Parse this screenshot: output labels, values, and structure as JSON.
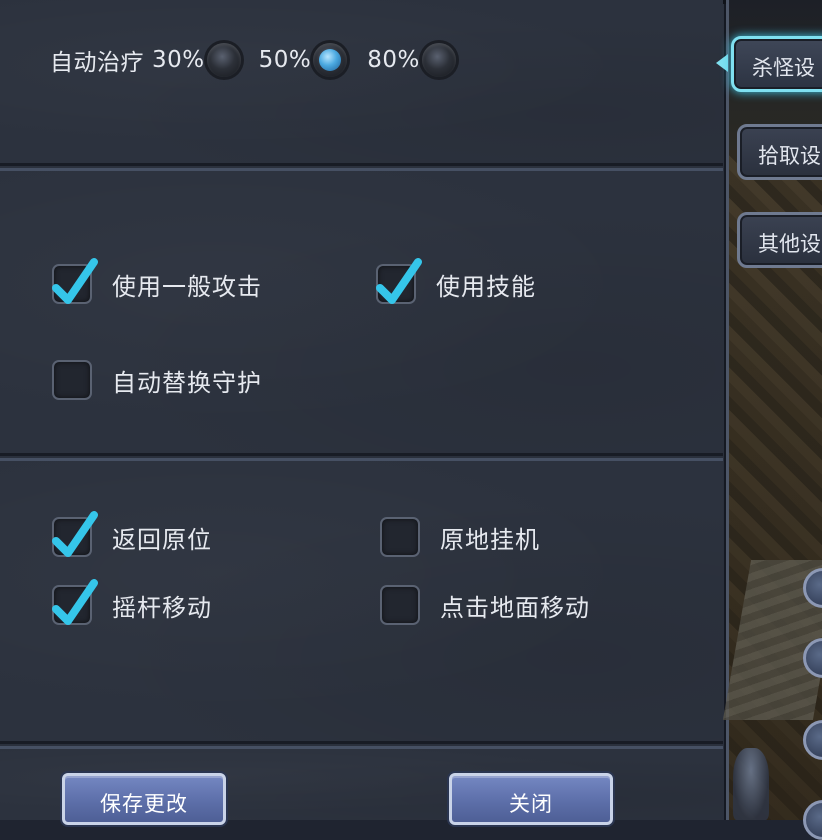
{
  "heal": {
    "label": "自动治疗",
    "options": [
      {
        "label": "30%",
        "selected": false
      },
      {
        "label": "50%",
        "selected": true
      },
      {
        "label": "80%",
        "selected": false
      }
    ]
  },
  "attack": {
    "normal_attack": {
      "label": "使用一般攻击",
      "checked": true
    },
    "use_skill": {
      "label": "使用技能",
      "checked": true
    },
    "auto_guard": {
      "label": "自动替换守护",
      "checked": false
    }
  },
  "movement": {
    "return_home": {
      "label": "返回原位",
      "checked": true
    },
    "idle_in_place": {
      "label": "原地挂机",
      "checked": false
    },
    "joystick_move": {
      "label": "摇杆移动",
      "checked": true
    },
    "tap_ground_move": {
      "label": "点击地面移动",
      "checked": false
    }
  },
  "buttons": {
    "save": "保存更改",
    "close": "关闭"
  },
  "tabs": [
    {
      "label": "杀怪设",
      "active": true
    },
    {
      "label": "拾取设",
      "active": false
    },
    {
      "label": "其他设",
      "active": false
    }
  ],
  "colors": {
    "checkmark": "#35c6ea",
    "active_tab_glow": "#7fe0f0",
    "button": "#6273b0"
  }
}
